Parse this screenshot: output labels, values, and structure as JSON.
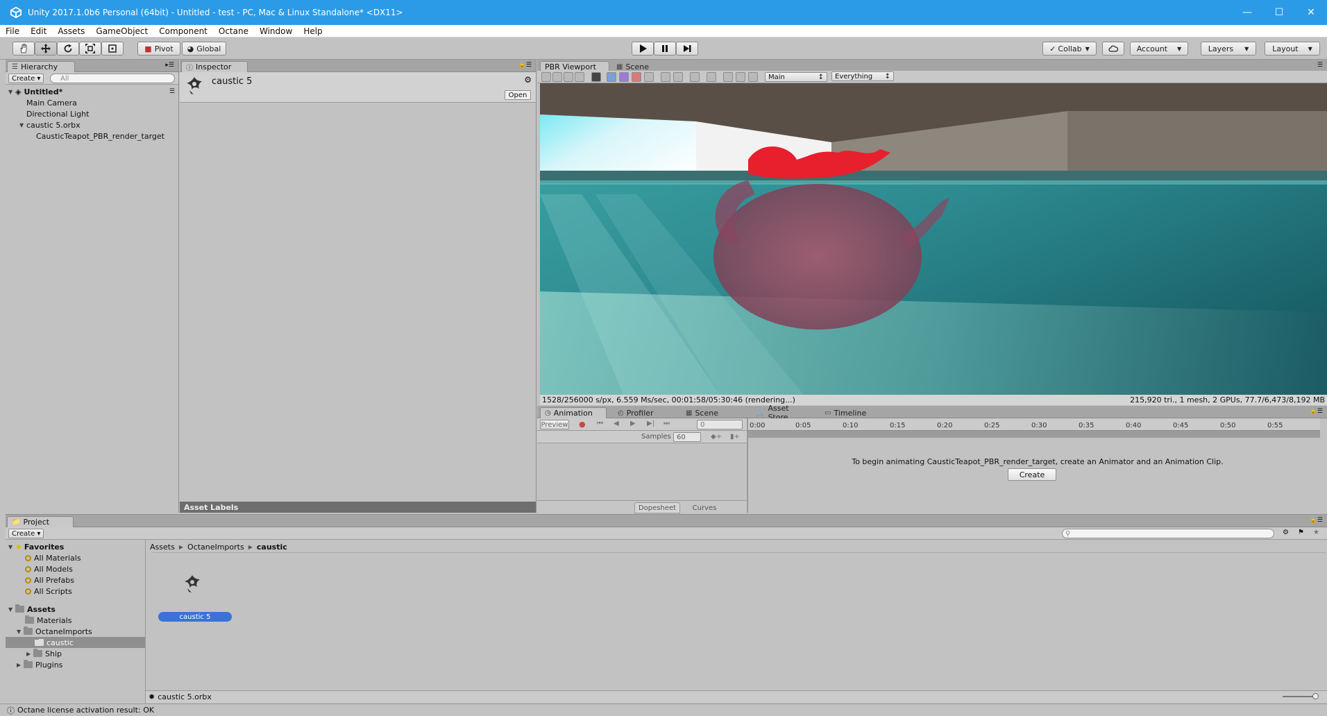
{
  "window": {
    "title": "Unity 2017.1.0b6 Personal (64bit) - Untitled - test - PC, Mac & Linux Standalone* <DX11>",
    "controls": {
      "minimize": "—",
      "maximize": "☐",
      "close": "✕"
    }
  },
  "menu": [
    "File",
    "Edit",
    "Assets",
    "GameObject",
    "Component",
    "Octane",
    "Window",
    "Help"
  ],
  "toolbar": {
    "pivot": "Pivot",
    "global": "Global",
    "collab": "Collab",
    "account": "Account",
    "layers": "Layers",
    "layout": "Layout"
  },
  "hierarchy": {
    "tab": "Hierarchy",
    "create": "Create",
    "search_placeholder": "All",
    "scene": "Untitled*",
    "items": [
      "Main Camera",
      "Directional Light",
      "caustic 5.orbx",
      "CausticTeapot_PBR_render_target"
    ]
  },
  "inspector": {
    "tab": "Inspector",
    "object_name": "caustic 5",
    "open": "Open",
    "asset_labels": "Asset Labels"
  },
  "viewport": {
    "tabs": [
      "PBR Viewport",
      "Scene"
    ],
    "camera": "Main",
    "layers": "Everything",
    "status_left": "1528/256000 s/px, 6.559 Ms/sec, 00:01:58/05:30:46 (rendering...)",
    "status_right": "215,920 tri., 1 mesh, 2 GPUs, 77.7/6,473/8,192 MB"
  },
  "animation": {
    "tabs": [
      "Animation",
      "Profiler",
      "Scene",
      "Asset Store",
      "Timeline"
    ],
    "preview": "Preview",
    "frame": "0",
    "samples_label": "Samples",
    "samples_value": "60",
    "ticks": [
      "0:00",
      "0:05",
      "0:10",
      "0:15",
      "0:20",
      "0:25",
      "0:30",
      "0:35",
      "0:40",
      "0:45",
      "0:50",
      "0:55"
    ],
    "message": "To begin animating CausticTeapot_PBR_render_target, create an Animator and an Animation Clip.",
    "create_button": "Create",
    "dopesheet": "Dopesheet",
    "curves": "Curves"
  },
  "project": {
    "tab": "Project",
    "create": "Create",
    "favorites_label": "Favorites",
    "favorites": [
      "All Materials",
      "All Models",
      "All Prefabs",
      "All Scripts"
    ],
    "assets_label": "Assets",
    "folders": [
      "Materials",
      "OctaneImports",
      "caustic",
      "Ship",
      "Plugins"
    ],
    "breadcrumb": [
      "Assets",
      "OctaneImports",
      "caustic"
    ],
    "asset_item": "caustic 5",
    "selected_file": "caustic 5.orbx"
  },
  "status": {
    "message": "Octane license activation result: OK"
  },
  "colors": {
    "titlebar": "#2b9be8",
    "selection": "#3a72d8",
    "panel": "#c2c2c2",
    "play_accent": "#111111"
  }
}
